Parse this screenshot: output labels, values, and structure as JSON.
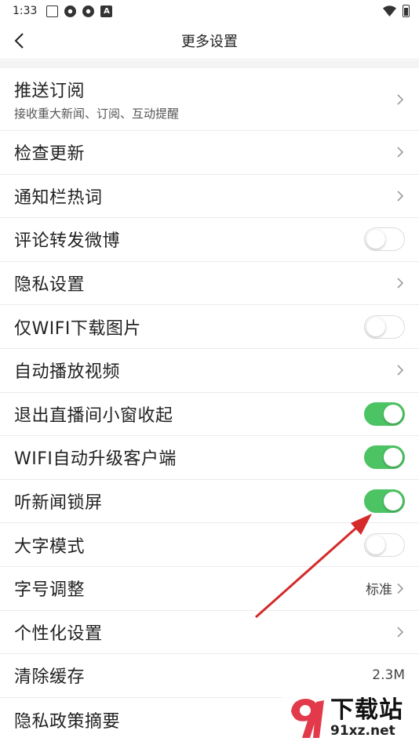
{
  "status_bar": {
    "time": "1:33",
    "notif_letter": "A",
    "icons": [
      "grid-icon",
      "clover-icon",
      "clover-icon",
      "letter-a-icon",
      "wifi-icon",
      "battery-icon"
    ]
  },
  "nav": {
    "title": "更多设置",
    "back_icon": "chevron-left-icon"
  },
  "settings": [
    {
      "label": "推送订阅",
      "sub": "接收重大新闻、订阅、互动提醒",
      "control": "chevron"
    },
    {
      "label": "检查更新",
      "control": "chevron"
    },
    {
      "label": "通知栏热词",
      "control": "chevron"
    },
    {
      "label": "评论转发微博",
      "control": "toggle",
      "on": false
    },
    {
      "label": "隐私设置",
      "control": "chevron"
    },
    {
      "label": "仅WIFI下载图片",
      "control": "toggle",
      "on": false
    },
    {
      "label": "自动播放视频",
      "control": "chevron"
    },
    {
      "label": "退出直播间小窗收起",
      "control": "toggle",
      "on": true
    },
    {
      "label": "WIFI自动升级客户端",
      "control": "toggle",
      "on": true
    },
    {
      "label": "听新闻锁屏",
      "control": "toggle",
      "on": true
    },
    {
      "label": "大字模式",
      "control": "toggle",
      "on": false
    },
    {
      "label": "字号调整",
      "control": "chevron",
      "value": "标准"
    },
    {
      "label": "个性化设置",
      "control": "chevron"
    },
    {
      "label": "清除缓存",
      "control": "value",
      "value": "2.3M"
    },
    {
      "label": "隐私政策摘要",
      "control": "none"
    }
  ],
  "colors": {
    "toggle_on": "#4cc464",
    "arrow": "#d42a2a",
    "divider": "#ececec"
  },
  "watermark": {
    "cn": "下载站",
    "url": "91xz.net"
  }
}
